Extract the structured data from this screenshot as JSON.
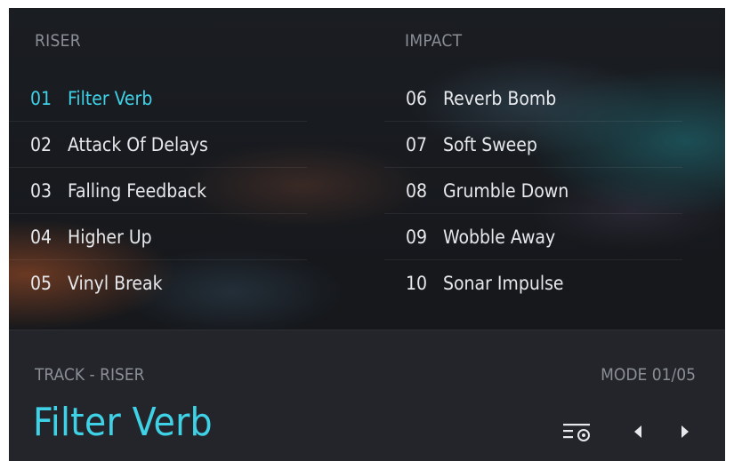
{
  "columns": {
    "left": {
      "header": "RISER"
    },
    "right": {
      "header": "IMPACT"
    }
  },
  "riser_tracks": [
    {
      "num": "01",
      "name": "Filter Verb",
      "active": true
    },
    {
      "num": "02",
      "name": "Attack Of Delays",
      "active": false
    },
    {
      "num": "03",
      "name": "Falling Feedback",
      "active": false
    },
    {
      "num": "04",
      "name": "Higher Up",
      "active": false
    },
    {
      "num": "05",
      "name": "Vinyl Break",
      "active": false
    }
  ],
  "impact_tracks": [
    {
      "num": "06",
      "name": "Reverb Bomb",
      "active": false
    },
    {
      "num": "07",
      "name": "Soft Sweep",
      "active": false
    },
    {
      "num": "08",
      "name": "Grumble Down",
      "active": false
    },
    {
      "num": "09",
      "name": "Wobble Away",
      "active": false
    },
    {
      "num": "10",
      "name": "Sonar Impulse",
      "active": false
    }
  ],
  "footer": {
    "track_label": "TRACK - RISER",
    "mode_label": "MODE 01/05",
    "selected_title": "Filter Verb",
    "icons": {
      "view": "list-view-icon",
      "prev": "caret-left-icon",
      "next": "caret-right-icon"
    }
  },
  "colors": {
    "accent": "#3fd1e6",
    "text": "#e6e8ec",
    "muted": "#8a8e95",
    "footer_bg": "#23252a"
  }
}
